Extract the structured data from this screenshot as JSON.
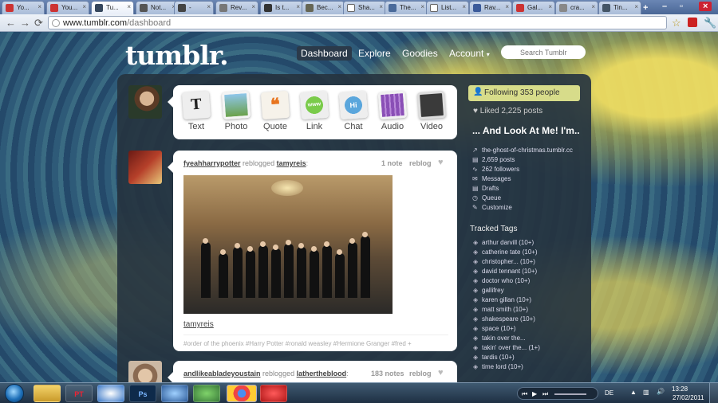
{
  "browser": {
    "tabs": [
      {
        "label": "Yo..."
      },
      {
        "label": "You..."
      },
      {
        "label": "Tu..."
      },
      {
        "label": "Not..."
      },
      {
        "label": "-"
      },
      {
        "label": "Rev..."
      },
      {
        "label": "Is t..."
      },
      {
        "label": "Bec..."
      },
      {
        "label": "Sha..."
      },
      {
        "label": "The..."
      },
      {
        "label": "List..."
      },
      {
        "label": "Rav..."
      },
      {
        "label": "Gal..."
      },
      {
        "label": "cra..."
      },
      {
        "label": "Tin..."
      }
    ],
    "url_host": "www.tumblr.com",
    "url_path": "/dashboard"
  },
  "tumblr": {
    "logo": "tumblr.",
    "nav": {
      "dashboard": "Dashboard",
      "explore": "Explore",
      "goodies": "Goodies",
      "account": "Account"
    },
    "search_placeholder": "Search Tumblr",
    "post_types": [
      "Text",
      "Photo",
      "Quote",
      "Link",
      "Chat",
      "Audio",
      "Video"
    ],
    "post_type_glyphs": {
      "text": "T",
      "quote": "❝",
      "link": "www",
      "chat": "Hi"
    },
    "posts": [
      {
        "author": "fyeahharrypotter",
        "action": "reblogged",
        "source": "tamyreis",
        "notes": "1 note",
        "reblog": "reblog",
        "caption_user": "tamyreis",
        "tags": "#order of the phoenix   #Harry Potter   #ronald weasley   #Hermione Granger   #fred +"
      },
      {
        "author": "andlikeabladeyoustain",
        "action": "reblogged",
        "source": "lathertheblood",
        "notes": "183 notes",
        "reblog": "reblog"
      }
    ],
    "sidebar": {
      "following": "Following 353 people",
      "liked": "Liked 2,225 posts",
      "blog_title": "... And Look At Me! I'm..",
      "blog_links": [
        "the-ghost-of-christmas.tumblr.cc",
        "2,659 posts",
        "262 followers",
        "Messages",
        "Drafts",
        "Queue",
        "Customize"
      ],
      "tracked_heading": "Tracked Tags",
      "tracked_tags": [
        "arthur darvill (10+)",
        "catherine tate (10+)",
        "christopher... (10+)",
        "david tennant (10+)",
        "doctor who (10+)",
        "gallifrey",
        "karen gillan (10+)",
        "matt smith (10+)",
        "shakespeare (10+)",
        "space (10+)",
        "takin over the...",
        "takin' over the... (1+)",
        "tardis (10+)",
        "time lord (10+)"
      ]
    }
  },
  "taskbar": {
    "language": "DE",
    "time": "13:28",
    "date": "27/02/2011",
    "app_labels": {
      "acrobat": "PT",
      "photoshop": "Ps"
    }
  }
}
